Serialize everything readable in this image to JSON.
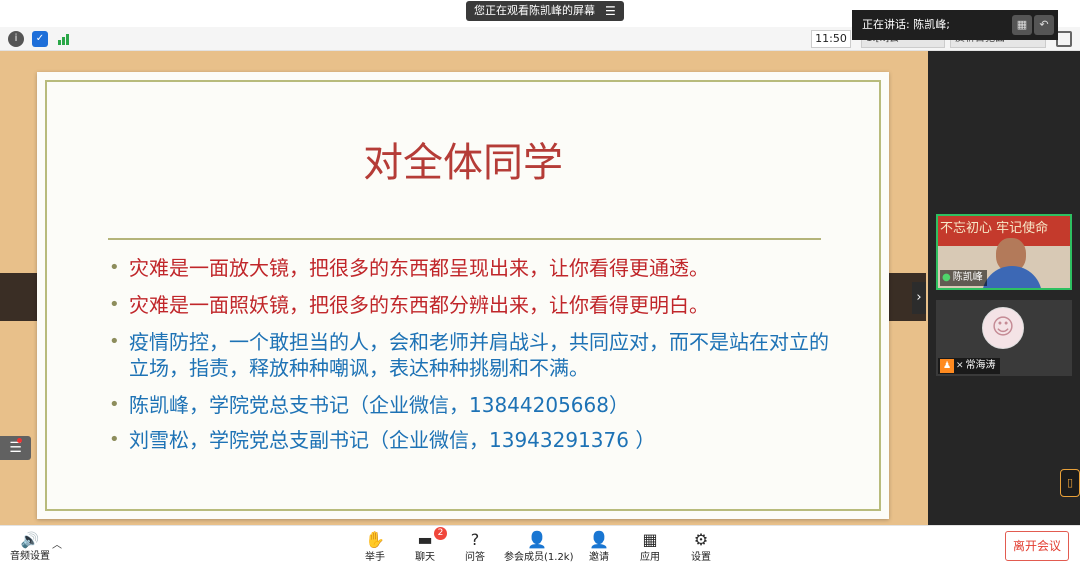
{
  "top": {
    "share_notice": "您正在观看陈凯峰的屏幕",
    "speaker_label": "正在讲话: 陈凯峰;"
  },
  "toolbar": {
    "clock": "11:50",
    "tab1": "1.[k]会",
    "tab2": "反析首犯面"
  },
  "slide": {
    "title": "对全体同学",
    "bullets": [
      "灾难是一面放大镜，把很多的东西都呈现出来，让你看得更通透。",
      "灾难是一面照妖镜，把很多的东西都分辨出来，让你看得更明白。",
      "疫情防控，一个敢担当的人，会和老师并肩战斗，共同应对，而不是站在对立的立场，指责，释放种种嘲讽，表达种种挑剔和不满。",
      "陈凯峰，学院党总支书记（企业微信，13844205668）",
      "刘雪松，学院党总支副书记（企业微信，13943291376 ）"
    ]
  },
  "participants": [
    {
      "name": "陈凯峰",
      "banner": "不忘初心 牢记使命"
    },
    {
      "name": "常海涛"
    }
  ],
  "bottom": {
    "audio_settings": "音频设置",
    "raise_hand": "举手",
    "chat": "聊天",
    "chat_badge": "2",
    "qa": "问答",
    "members": "参会成员(1.2k)",
    "invite": "邀请",
    "apps": "应用",
    "settings": "设置",
    "leave": "离开会议"
  },
  "colors": {
    "slide_title": "#b53c37",
    "bullet_red": "#c0262a",
    "bullet_blue": "#1d72b5",
    "leave": "#e23d30",
    "speaking_border": "#2ec061"
  }
}
